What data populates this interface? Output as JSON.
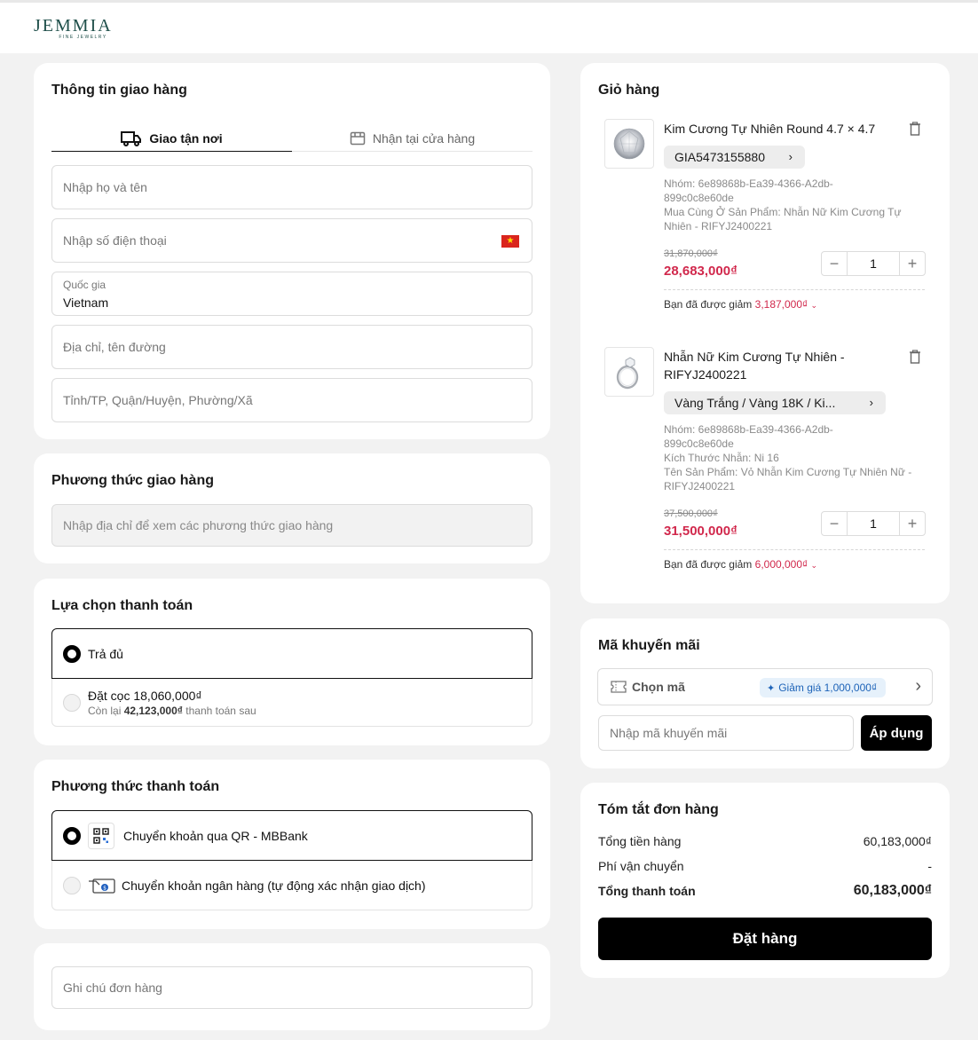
{
  "brand": {
    "name": "JEMMIA",
    "tagline": "FINE JEWELRY"
  },
  "shipping_info": {
    "title": "Thông tin giao hàng",
    "tabs": [
      {
        "label": "Giao tận nơi",
        "active": true
      },
      {
        "label": "Nhận tại cửa hàng",
        "active": false
      }
    ],
    "name_placeholder": "Nhập họ và tên",
    "phone_placeholder": "Nhập số điện thoại",
    "country_label": "Quốc gia",
    "country_value": "Vietnam",
    "address_placeholder": "Địa chỉ, tên đường",
    "region_placeholder": "Tỉnh/TP, Quận/Huyện, Phường/Xã"
  },
  "shipping_method": {
    "title": "Phương thức giao hàng",
    "placeholder": "Nhập địa chỉ để xem các phương thức giao hàng"
  },
  "payment_choice": {
    "title": "Lựa chọn thanh toán",
    "options": [
      {
        "label": "Trả đủ",
        "selected": true
      },
      {
        "label": "Đặt cọc 18,060,000₫",
        "sub_prefix": "Còn lại",
        "sub_amount": "42,123,000₫",
        "sub_suffix": "thanh toán sau",
        "selected": false
      }
    ]
  },
  "payment_method": {
    "title": "Phương thức thanh toán",
    "options": [
      {
        "label": "Chuyển khoản qua QR - MBBank",
        "icon": "qr-code-icon",
        "selected": true
      },
      {
        "label": "Chuyển khoản ngân hàng (tự động xác nhận giao dịch)",
        "icon": "bank-transfer-icon",
        "selected": false
      }
    ]
  },
  "note": {
    "placeholder": "Ghi chú đơn hàng"
  },
  "cart": {
    "title": "Giỏ hàng",
    "items": [
      {
        "name": "Kim Cương Tự Nhiên Round 4.7 × 4.7",
        "variant": "GIA5473155880",
        "meta": [
          "Nhóm: 6e89868b-Ea39-4366-A2db-",
          "899c0c8e60de",
          "Mua Cùng Ở Sản Phẩm: Nhẫn Nữ Kim Cương Tự",
          "Nhiên - RIFYJ2400221"
        ],
        "old_price": "31,870,000₫",
        "price": "28,683,000₫",
        "quantity": "1",
        "saving_label": "Bạn đã được giảm",
        "saving_amount": "3,187,000₫"
      },
      {
        "name_line1": "Nhẫn Nữ Kim Cương Tự Nhiên -",
        "name_line2": "RIFYJ2400221",
        "variant": "Vàng Trắng / Vàng 18K / Ki...",
        "meta": [
          "Nhóm: 6e89868b-Ea39-4366-A2db-",
          "899c0c8e60de",
          "Kích Thước Nhẫn: Ni 16",
          "Tên Sản Phẩm: Vỏ Nhẫn Kim Cương Tự Nhiên Nữ -",
          "RIFYJ2400221"
        ],
        "old_price": "37,500,000₫",
        "price": "31,500,000₫",
        "quantity": "1",
        "saving_label": "Bạn đã được giảm",
        "saving_amount": "6,000,000₫"
      }
    ]
  },
  "promo": {
    "title": "Mã khuyến mãi",
    "choose_label": "Chọn mã",
    "badge": "Giảm giá 1,000,000₫",
    "input_placeholder": "Nhập mã khuyến mãi",
    "apply_label": "Áp dụng"
  },
  "summary": {
    "title": "Tóm tắt đơn hàng",
    "subtotal_label": "Tổng tiền hàng",
    "subtotal_value": "60,183,000₫",
    "shipping_label": "Phí vận chuyển",
    "shipping_value": "-",
    "total_label": "Tổng thanh toán",
    "total_value": "60,183,000₫",
    "order_button": "Đặt hàng"
  },
  "colors": {
    "accent_price": "#d1284c",
    "brand": "#1f4f4a",
    "primary_button": "#000000"
  }
}
